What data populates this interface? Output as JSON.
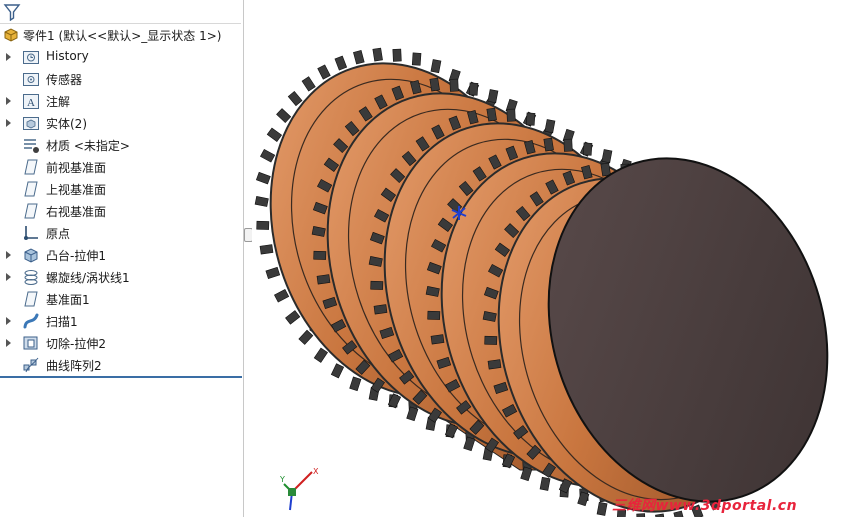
{
  "feature_tree": {
    "root": {
      "label": "零件1  (默认<<默认>_显示状态 1>)"
    },
    "items": [
      {
        "label": "History",
        "icon": "history-folder-icon",
        "expandable": true
      },
      {
        "label": "传感器",
        "icon": "sensor-icon",
        "expandable": false
      },
      {
        "label": "注解",
        "icon": "annotation-icon",
        "expandable": true
      },
      {
        "label": "实体(2)",
        "icon": "solid-bodies-icon",
        "expandable": true
      },
      {
        "label": "材质 <未指定>",
        "icon": "material-icon",
        "expandable": false
      },
      {
        "label": "前视基准面",
        "icon": "plane-icon",
        "expandable": false
      },
      {
        "label": "上视基准面",
        "icon": "plane-icon",
        "expandable": false
      },
      {
        "label": "右视基准面",
        "icon": "plane-icon",
        "expandable": false
      },
      {
        "label": "原点",
        "icon": "origin-icon",
        "expandable": false
      },
      {
        "label": "凸台-拉伸1",
        "icon": "boss-extrude-icon",
        "expandable": true
      },
      {
        "label": "螺旋线/涡状线1",
        "icon": "helix-icon",
        "expandable": true
      },
      {
        "label": "基准面1",
        "icon": "plane-icon",
        "expandable": false
      },
      {
        "label": "扫描1",
        "icon": "sweep-icon",
        "expandable": true
      },
      {
        "label": "切除-拉伸2",
        "icon": "cut-extrude-icon",
        "expandable": true
      },
      {
        "label": "曲线阵列2",
        "icon": "curve-pattern-icon",
        "expandable": false
      }
    ]
  },
  "viewport": {
    "model": "copper-cylinder-with-helical-toothed-strip",
    "triad_labels": {
      "x": "X",
      "y": "Y"
    },
    "colors": {
      "copper": "#c9763f",
      "end_face": "#4a3d3d",
      "teeth": "#3a3a3a"
    }
  },
  "watermark": {
    "text": "三维网www.3dportal.cn"
  },
  "colors": {
    "selection_line": "#3a6ea5",
    "watermark": "#e8243c"
  }
}
